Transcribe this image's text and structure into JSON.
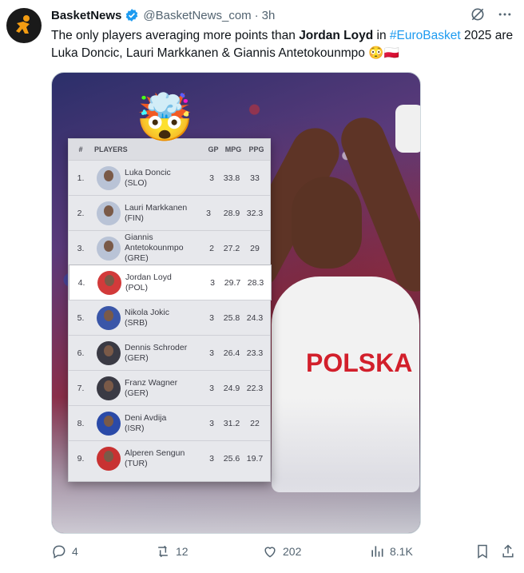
{
  "tweet": {
    "author_name": "BasketNews",
    "handle": "@BasketNews_com",
    "separator": "·",
    "time": "3h",
    "text_parts": {
      "p1": "The only players averaging more points than ",
      "bold": "Jordan Loyd",
      "p2": " in ",
      "hashtag": "#EuroBasket",
      "p3": " 2025 are Luka Doncic, Lauri Markkanen & Giannis Antetokounmpo 😳🇵🇱"
    }
  },
  "media": {
    "jersey_text": "POLSKA",
    "emoji": "🤯",
    "table": {
      "headers": [
        "#",
        "PLAYERS",
        "GP",
        "MPG",
        "PPG"
      ],
      "rows": [
        {
          "rank": "1.",
          "name": "Luka Doncic",
          "country": "(SLO)",
          "gp": "3",
          "mpg": "33.8",
          "ppg": "33"
        },
        {
          "rank": "2.",
          "name": "Lauri Markkanen",
          "country": "(FIN)",
          "gp": "3",
          "mpg": "28.9",
          "ppg": "32.3"
        },
        {
          "rank": "3.",
          "name": "Giannis Antetokounmpo",
          "country": "(GRE)",
          "gp": "2",
          "mpg": "27.2",
          "ppg": "29"
        },
        {
          "rank": "4.",
          "name": "Jordan Loyd",
          "country": "(POL)",
          "gp": "3",
          "mpg": "29.7",
          "ppg": "28.3"
        },
        {
          "rank": "5.",
          "name": "Nikola Jokic",
          "country": "(SRB)",
          "gp": "3",
          "mpg": "25.8",
          "ppg": "24.3"
        },
        {
          "rank": "6.",
          "name": "Dennis Schroder",
          "country": "(GER)",
          "gp": "3",
          "mpg": "26.4",
          "ppg": "23.3"
        },
        {
          "rank": "7.",
          "name": "Franz Wagner",
          "country": "(GER)",
          "gp": "3",
          "mpg": "24.9",
          "ppg": "22.3"
        },
        {
          "rank": "8.",
          "name": "Deni Avdija",
          "country": "(ISR)",
          "gp": "3",
          "mpg": "31.2",
          "ppg": "22"
        },
        {
          "rank": "9.",
          "name": "Alperen Sengun",
          "country": "(TUR)",
          "gp": "3",
          "mpg": "25.6",
          "ppg": "19.7"
        }
      ]
    }
  },
  "actions": {
    "replies": "4",
    "reposts": "12",
    "likes": "202",
    "views": "8.1K"
  },
  "colors": {
    "link": "#1d9bf0",
    "verified": "#1d9bf0",
    "brand_orange": "#f39c12",
    "jersey_red": "#d21f2b"
  }
}
